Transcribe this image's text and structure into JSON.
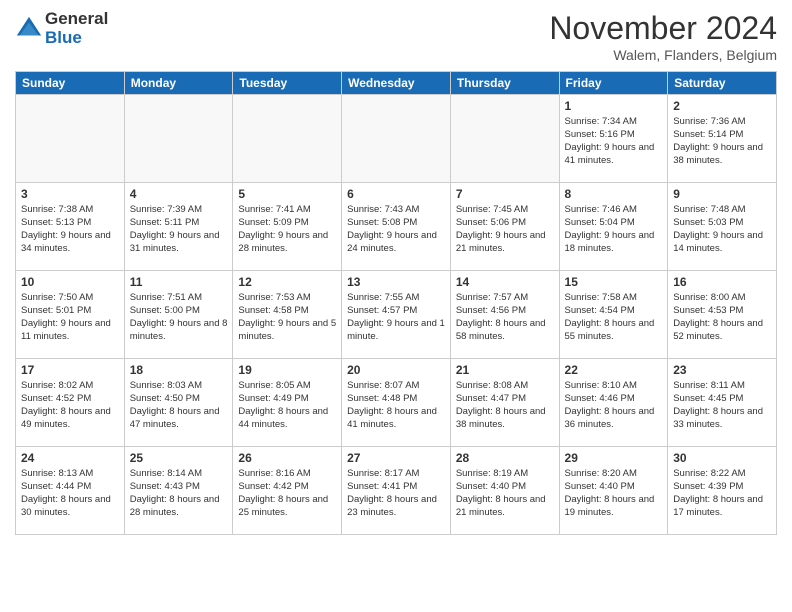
{
  "logo": {
    "general": "General",
    "blue": "Blue"
  },
  "title": "November 2024",
  "location": "Walem, Flanders, Belgium",
  "days_of_week": [
    "Sunday",
    "Monday",
    "Tuesday",
    "Wednesday",
    "Thursday",
    "Friday",
    "Saturday"
  ],
  "weeks": [
    [
      {
        "day": "",
        "info": ""
      },
      {
        "day": "",
        "info": ""
      },
      {
        "day": "",
        "info": ""
      },
      {
        "day": "",
        "info": ""
      },
      {
        "day": "",
        "info": ""
      },
      {
        "day": "1",
        "info": "Sunrise: 7:34 AM\nSunset: 5:16 PM\nDaylight: 9 hours and 41 minutes."
      },
      {
        "day": "2",
        "info": "Sunrise: 7:36 AM\nSunset: 5:14 PM\nDaylight: 9 hours and 38 minutes."
      }
    ],
    [
      {
        "day": "3",
        "info": "Sunrise: 7:38 AM\nSunset: 5:13 PM\nDaylight: 9 hours and 34 minutes."
      },
      {
        "day": "4",
        "info": "Sunrise: 7:39 AM\nSunset: 5:11 PM\nDaylight: 9 hours and 31 minutes."
      },
      {
        "day": "5",
        "info": "Sunrise: 7:41 AM\nSunset: 5:09 PM\nDaylight: 9 hours and 28 minutes."
      },
      {
        "day": "6",
        "info": "Sunrise: 7:43 AM\nSunset: 5:08 PM\nDaylight: 9 hours and 24 minutes."
      },
      {
        "day": "7",
        "info": "Sunrise: 7:45 AM\nSunset: 5:06 PM\nDaylight: 9 hours and 21 minutes."
      },
      {
        "day": "8",
        "info": "Sunrise: 7:46 AM\nSunset: 5:04 PM\nDaylight: 9 hours and 18 minutes."
      },
      {
        "day": "9",
        "info": "Sunrise: 7:48 AM\nSunset: 5:03 PM\nDaylight: 9 hours and 14 minutes."
      }
    ],
    [
      {
        "day": "10",
        "info": "Sunrise: 7:50 AM\nSunset: 5:01 PM\nDaylight: 9 hours and 11 minutes."
      },
      {
        "day": "11",
        "info": "Sunrise: 7:51 AM\nSunset: 5:00 PM\nDaylight: 9 hours and 8 minutes."
      },
      {
        "day": "12",
        "info": "Sunrise: 7:53 AM\nSunset: 4:58 PM\nDaylight: 9 hours and 5 minutes."
      },
      {
        "day": "13",
        "info": "Sunrise: 7:55 AM\nSunset: 4:57 PM\nDaylight: 9 hours and 1 minute."
      },
      {
        "day": "14",
        "info": "Sunrise: 7:57 AM\nSunset: 4:56 PM\nDaylight: 8 hours and 58 minutes."
      },
      {
        "day": "15",
        "info": "Sunrise: 7:58 AM\nSunset: 4:54 PM\nDaylight: 8 hours and 55 minutes."
      },
      {
        "day": "16",
        "info": "Sunrise: 8:00 AM\nSunset: 4:53 PM\nDaylight: 8 hours and 52 minutes."
      }
    ],
    [
      {
        "day": "17",
        "info": "Sunrise: 8:02 AM\nSunset: 4:52 PM\nDaylight: 8 hours and 49 minutes."
      },
      {
        "day": "18",
        "info": "Sunrise: 8:03 AM\nSunset: 4:50 PM\nDaylight: 8 hours and 47 minutes."
      },
      {
        "day": "19",
        "info": "Sunrise: 8:05 AM\nSunset: 4:49 PM\nDaylight: 8 hours and 44 minutes."
      },
      {
        "day": "20",
        "info": "Sunrise: 8:07 AM\nSunset: 4:48 PM\nDaylight: 8 hours and 41 minutes."
      },
      {
        "day": "21",
        "info": "Sunrise: 8:08 AM\nSunset: 4:47 PM\nDaylight: 8 hours and 38 minutes."
      },
      {
        "day": "22",
        "info": "Sunrise: 8:10 AM\nSunset: 4:46 PM\nDaylight: 8 hours and 36 minutes."
      },
      {
        "day": "23",
        "info": "Sunrise: 8:11 AM\nSunset: 4:45 PM\nDaylight: 8 hours and 33 minutes."
      }
    ],
    [
      {
        "day": "24",
        "info": "Sunrise: 8:13 AM\nSunset: 4:44 PM\nDaylight: 8 hours and 30 minutes."
      },
      {
        "day": "25",
        "info": "Sunrise: 8:14 AM\nSunset: 4:43 PM\nDaylight: 8 hours and 28 minutes."
      },
      {
        "day": "26",
        "info": "Sunrise: 8:16 AM\nSunset: 4:42 PM\nDaylight: 8 hours and 25 minutes."
      },
      {
        "day": "27",
        "info": "Sunrise: 8:17 AM\nSunset: 4:41 PM\nDaylight: 8 hours and 23 minutes."
      },
      {
        "day": "28",
        "info": "Sunrise: 8:19 AM\nSunset: 4:40 PM\nDaylight: 8 hours and 21 minutes."
      },
      {
        "day": "29",
        "info": "Sunrise: 8:20 AM\nSunset: 4:40 PM\nDaylight: 8 hours and 19 minutes."
      },
      {
        "day": "30",
        "info": "Sunrise: 8:22 AM\nSunset: 4:39 PM\nDaylight: 8 hours and 17 minutes."
      }
    ]
  ]
}
